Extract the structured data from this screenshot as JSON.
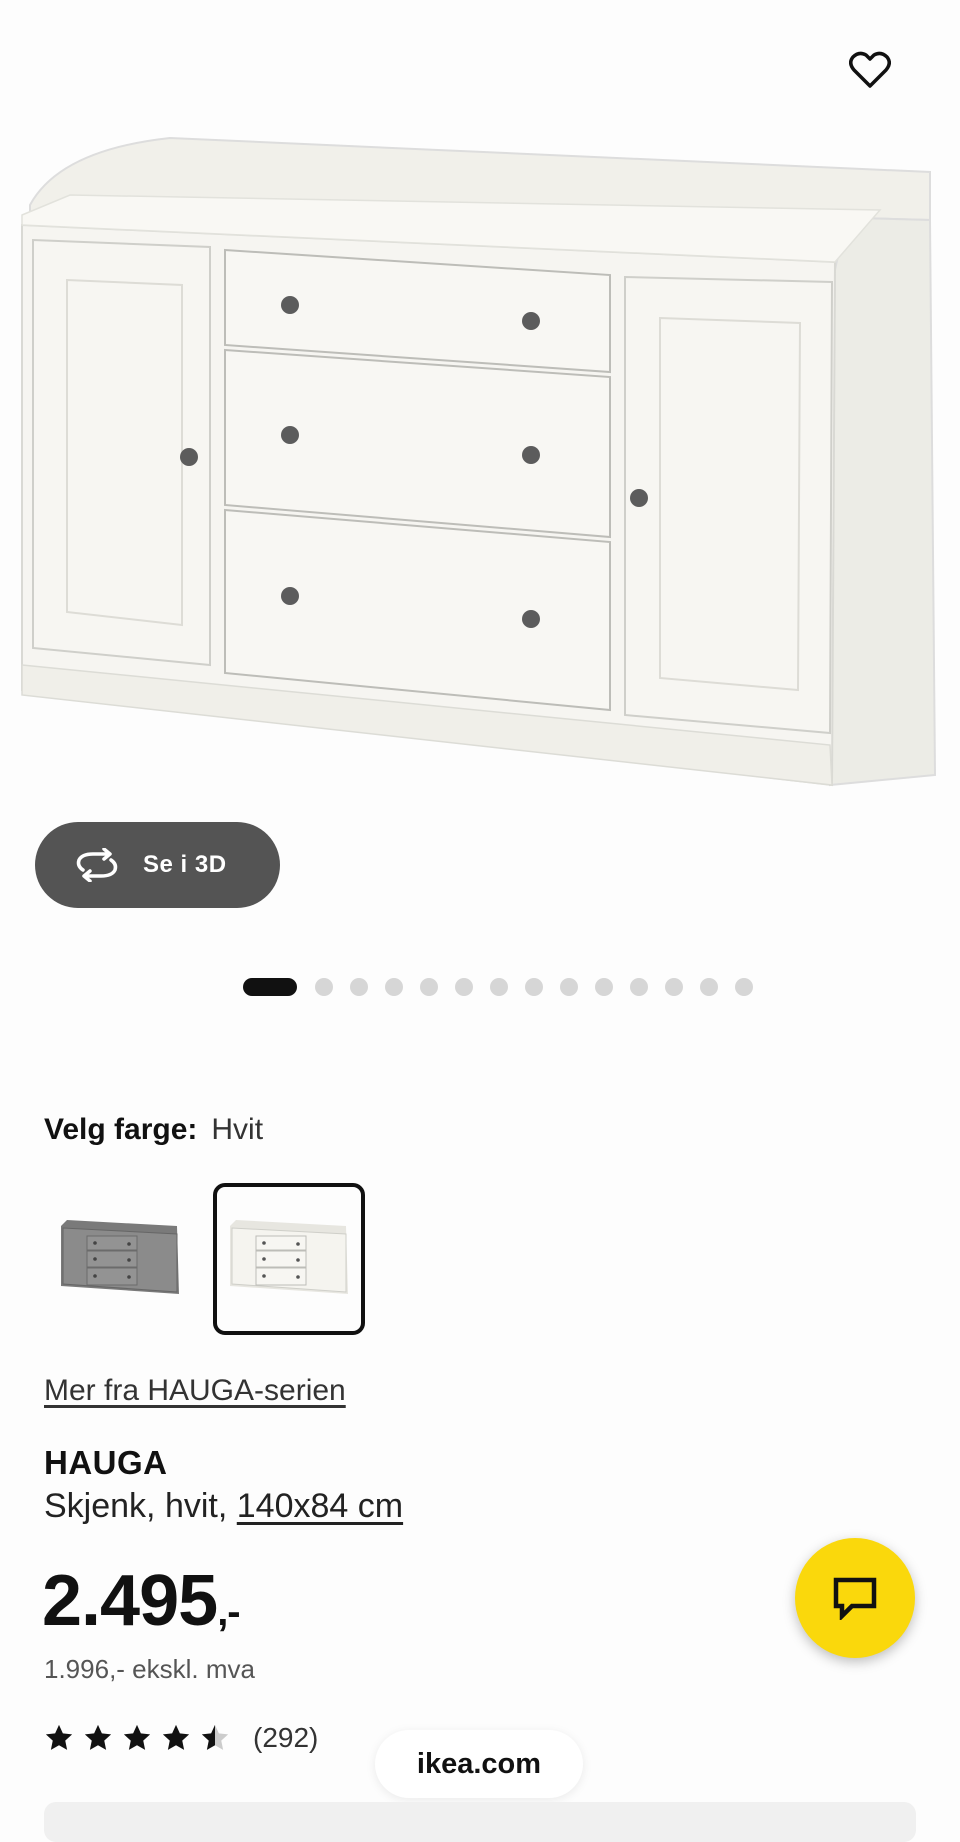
{
  "product_image": {
    "alt": "HAUGA sideboard white"
  },
  "actions": {
    "favorite_icon": "heart-outline-icon",
    "view_3d_label": "Se i 3D",
    "view_3d_icon": "rotate-3d-icon"
  },
  "carousel": {
    "count": 14,
    "active_index": 0
  },
  "color": {
    "label": "Velg farge:",
    "selected": "Hvit",
    "options": [
      {
        "name": "Grå",
        "selected": false
      },
      {
        "name": "Hvit",
        "selected": true
      }
    ]
  },
  "series_link": "Mer fra HAUGA-serien",
  "product": {
    "name": "HAUGA",
    "description_prefix": "Skjenk, hvit,",
    "size": "140x84 cm"
  },
  "price": {
    "amount": "2.495",
    "suffix": ",-",
    "ex_vat": "1.996,- ekskl. mva"
  },
  "rating": {
    "value": 4.5,
    "count": "(292)"
  },
  "chat": {
    "icon": "chat-bubble-icon",
    "color": "#fad80c"
  },
  "browser": {
    "domain": "ikea.com"
  }
}
